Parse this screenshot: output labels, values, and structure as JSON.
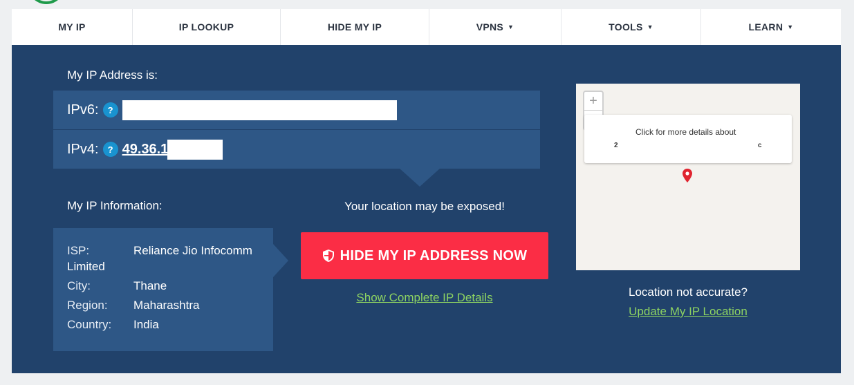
{
  "nav": {
    "items": [
      {
        "label": "MY IP",
        "caret": ""
      },
      {
        "label": "IP LOOKUP",
        "caret": ""
      },
      {
        "label": "HIDE MY IP",
        "caret": ""
      },
      {
        "label": "VPNS",
        "caret": "▼"
      },
      {
        "label": "TOOLS",
        "caret": "▼"
      },
      {
        "label": "LEARN",
        "caret": "▼"
      }
    ]
  },
  "address": {
    "heading": "My IP Address is:",
    "ipv6_label": "IPv6:",
    "ipv4_label": "IPv4:",
    "help_glyph": "?",
    "ipv4_value": "49.36.1"
  },
  "info": {
    "heading": "My IP Information:",
    "isp_label": "ISP:",
    "isp_value": "Reliance Jio Infocomm",
    "isp_value_cont": "Limited",
    "city_label": "City:",
    "city_value": "Thane",
    "region_label": "Region:",
    "region_value": "Maharashtra",
    "country_label": "Country:",
    "country_value": "India"
  },
  "cta": {
    "warning": "Your location may be exposed!",
    "button_label": "HIDE MY IP ADDRESS NOW",
    "details_link": "Show Complete IP Details"
  },
  "map": {
    "zoom_in": "+",
    "zoom_out": "−",
    "popup_text": "Click for more details about",
    "popup_left": "2",
    "popup_right": "c"
  },
  "location": {
    "question": "Location not accurate?",
    "update_link": "Update My IP Location"
  },
  "colors": {
    "panel": "#21426b",
    "row": "#2e5786",
    "button": "#fb2d45",
    "link": "#8dd362",
    "help": "#1993d0"
  }
}
